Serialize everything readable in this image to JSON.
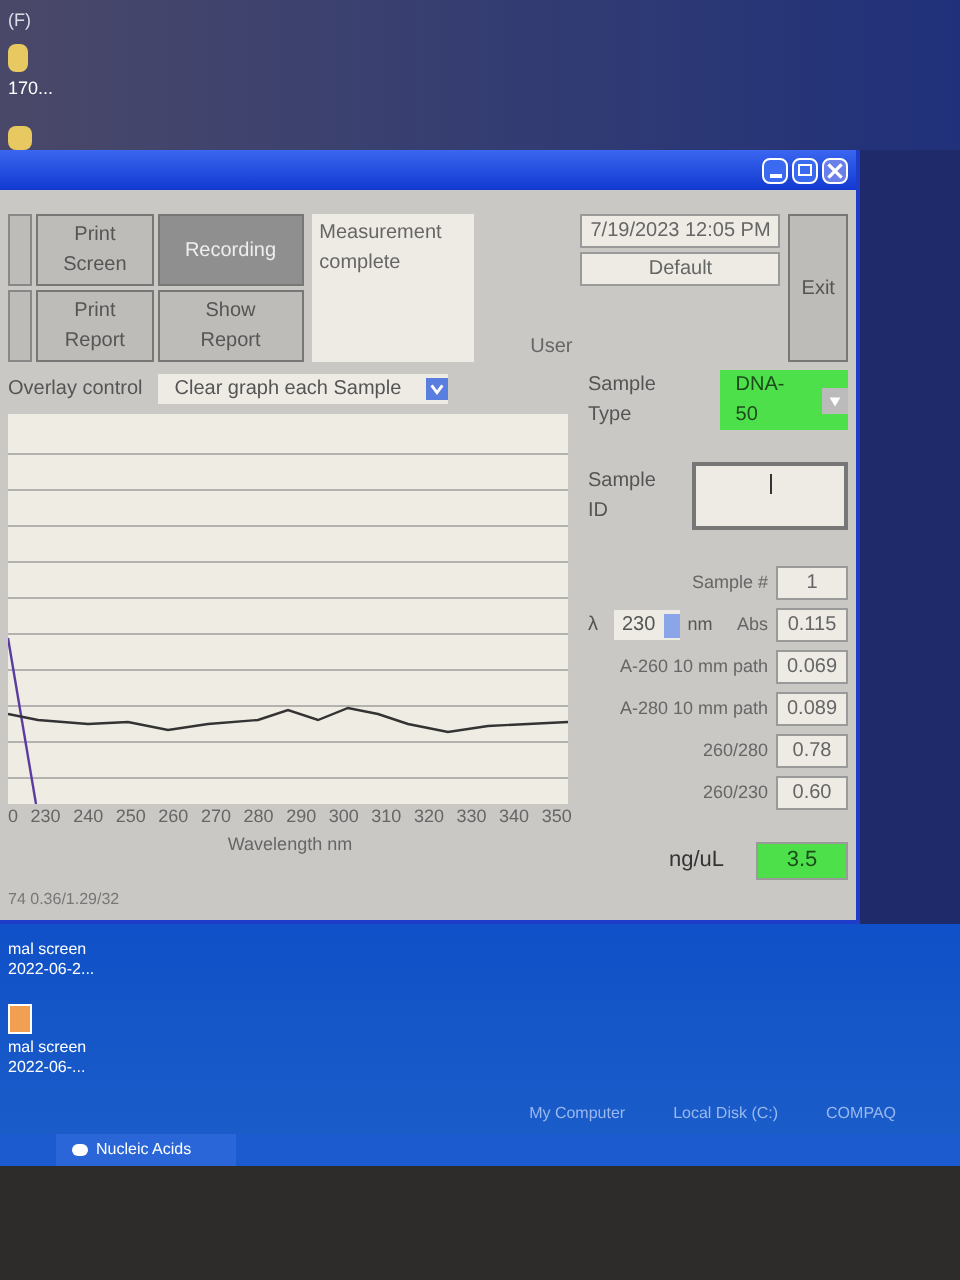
{
  "desktop_top": {
    "drive_label": "(F)",
    "icons": [
      {
        "label": "170..."
      }
    ]
  },
  "window": {
    "toolbar": {
      "buttons": [
        {
          "label": "Print Screen",
          "pressed": false
        },
        {
          "label": "Recording",
          "pressed": true
        },
        {
          "label": "Print Report",
          "pressed": false
        },
        {
          "label": "Show Report",
          "pressed": false
        }
      ],
      "status": "Measurement complete",
      "datetime": "7/19/2023  12:05 PM",
      "user_label": "User",
      "user": "Default",
      "exit": "Exit"
    },
    "overlay": {
      "label": "Overlay control",
      "value": "Clear graph each Sample"
    },
    "chart": {
      "xticks": [
        "0",
        "230",
        "240",
        "250",
        "260",
        "270",
        "280",
        "290",
        "300",
        "310",
        "320",
        "330",
        "340",
        "350"
      ],
      "xlabel": "Wavelength nm"
    },
    "panel": {
      "sample_type_label": "Sample Type",
      "sample_type": "DNA-50",
      "sample_id_label": "Sample ID",
      "lambda_symbol": "λ",
      "lambda": "230",
      "lambda_unit": "nm",
      "readings": [
        {
          "label": "Sample #",
          "value": "1"
        },
        {
          "label": "Abs",
          "value": "0.115"
        },
        {
          "label": "A-260 10 mm path",
          "value": "0.069"
        },
        {
          "label": "A-280 10 mm path",
          "value": "0.089"
        },
        {
          "label": "260/280",
          "value": "0.78"
        },
        {
          "label": "260/230",
          "value": "0.60"
        }
      ],
      "conc_label": "ng/uL",
      "conc": "3.5"
    },
    "status_line": "74 0.36/1.29/32"
  },
  "desktop_bottom": {
    "icons": [
      {
        "label": "mal screen 2022-06-2..."
      },
      {
        "label": "mal screen 2022-06-..."
      }
    ]
  },
  "taskbar": {
    "task": "Nucleic Acids",
    "tray": [
      "My Computer",
      "Local Disk (C:)",
      "COMPAQ"
    ]
  }
}
